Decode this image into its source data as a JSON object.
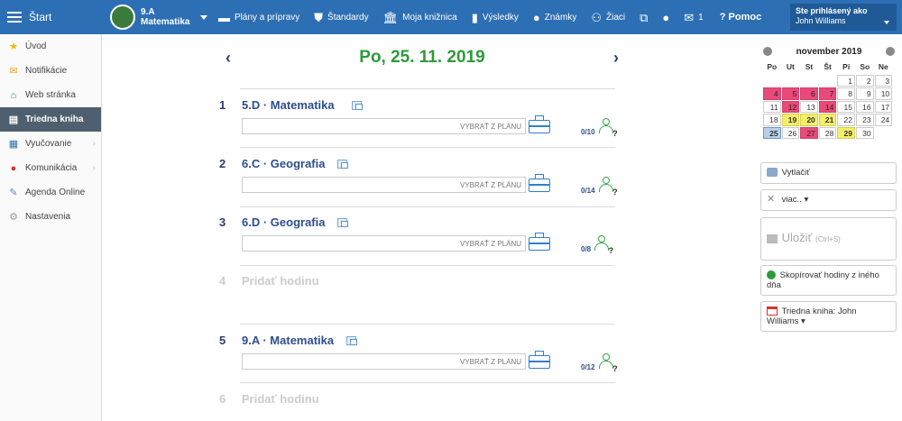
{
  "topbar": {
    "start_label": "Štart",
    "class_line1": "9.A",
    "class_line2": "Matematika",
    "nav": [
      {
        "icon": "calendar-icon",
        "glyph": "▬",
        "label": "Plány a prípravy"
      },
      {
        "icon": "shield-icon",
        "glyph": "⛊",
        "label": "Štandardy"
      },
      {
        "icon": "library-icon",
        "glyph": "🏛",
        "label": "Moja knižnica"
      },
      {
        "icon": "bar-chart-icon",
        "glyph": "▮",
        "label": "Výsledky"
      },
      {
        "icon": "grade-icon",
        "glyph": "●",
        "label": "Známky"
      },
      {
        "icon": "students-icon",
        "glyph": "⚇",
        "label": "Žiaci"
      },
      {
        "icon": "cast-icon",
        "glyph": "⧉",
        "label": ""
      },
      {
        "icon": "chat-icon",
        "glyph": "●",
        "label": ""
      },
      {
        "icon": "mail-icon",
        "glyph": "✉",
        "label": "1"
      }
    ],
    "help_label": "? Pomoc",
    "user_line1": "Ste prihlásený ako",
    "user_line2": "John Williams"
  },
  "sidebar": {
    "items": [
      {
        "label": "Úvod",
        "icon": "star-icon",
        "glyph": "★",
        "color": "#f0b400",
        "active": false,
        "chevron": false
      },
      {
        "label": "Notifikácie",
        "icon": "envelope-icon",
        "glyph": "✉",
        "color": "#f5a623",
        "active": false,
        "chevron": false
      },
      {
        "label": "Web stránka",
        "icon": "house-icon",
        "glyph": "⌂",
        "color": "#1e9a4a",
        "active": false,
        "chevron": false
      },
      {
        "label": "Triedna kniha",
        "icon": "book-icon",
        "glyph": "▤",
        "color": "#ffffff",
        "active": true,
        "chevron": false
      },
      {
        "label": "Vyučovanie",
        "icon": "teaching-icon",
        "glyph": "▦",
        "color": "#2d6fb4",
        "active": false,
        "chevron": true
      },
      {
        "label": "Komunikácia",
        "icon": "communication-icon",
        "glyph": "●",
        "color": "#d9342b",
        "active": false,
        "chevron": true
      },
      {
        "label": "Agenda Online",
        "icon": "pen-icon",
        "glyph": "✎",
        "color": "#5b7fc8",
        "active": false,
        "chevron": false
      },
      {
        "label": "Nastavenia",
        "icon": "gear-icon",
        "glyph": "⚙",
        "color": "#999999",
        "active": false,
        "chevron": false
      }
    ]
  },
  "main": {
    "date_title": "Po, 25. 11. 2019",
    "prev_arrow": "‹",
    "next_arrow": "›",
    "lessons": [
      {
        "num": "1",
        "title": "5.D · Matematika",
        "plan_label": "VYBRAŤ Z PLÁNU",
        "attendance": "0/10"
      },
      {
        "num": "2",
        "title": "6.C · Geografia",
        "plan_label": "VYBRAŤ Z PLÁNU",
        "attendance": "0/14"
      },
      {
        "num": "3",
        "title": "6.D · Geografia",
        "plan_label": "VYBRAŤ Z PLÁNU",
        "attendance": "0/8"
      },
      {
        "num": "5",
        "title": "9.A · Matematika",
        "plan_label": "VYBRAŤ Z PLÁNU",
        "attendance": "0/12"
      }
    ],
    "empty_slots": [
      {
        "num": "4",
        "label": "Pridať hodinu"
      },
      {
        "num": "6",
        "label": "Pridať hodinu"
      }
    ]
  },
  "calendar": {
    "month_label": "november 2019",
    "weekdays": [
      "Po",
      "Ut",
      "St",
      "Št",
      "Pi",
      "So",
      "Ne"
    ],
    "weeks": [
      [
        {
          "d": ""
        },
        {
          "d": ""
        },
        {
          "d": ""
        },
        {
          "d": ""
        },
        {
          "d": "1",
          "s": "plain"
        },
        {
          "d": "2",
          "s": "plain"
        },
        {
          "d": "3",
          "s": "plain"
        }
      ],
      [
        {
          "d": "4",
          "s": "pink"
        },
        {
          "d": "5",
          "s": "pink"
        },
        {
          "d": "6",
          "s": "pink"
        },
        {
          "d": "7",
          "s": "pink"
        },
        {
          "d": "8",
          "s": "plain"
        },
        {
          "d": "9",
          "s": "plain"
        },
        {
          "d": "10",
          "s": "plain"
        }
      ],
      [
        {
          "d": "11",
          "s": "plain"
        },
        {
          "d": "12",
          "s": "pink"
        },
        {
          "d": "13",
          "s": "plain"
        },
        {
          "d": "14",
          "s": "pink"
        },
        {
          "d": "15",
          "s": "plain"
        },
        {
          "d": "16",
          "s": "plain"
        },
        {
          "d": "17",
          "s": "plain"
        }
      ],
      [
        {
          "d": "18",
          "s": "plain"
        },
        {
          "d": "19",
          "s": "yellow"
        },
        {
          "d": "20",
          "s": "yellow"
        },
        {
          "d": "21",
          "s": "yellow"
        },
        {
          "d": "22",
          "s": "plain"
        },
        {
          "d": "23",
          "s": "plain"
        },
        {
          "d": "24",
          "s": "plain"
        }
      ],
      [
        {
          "d": "25",
          "s": "today"
        },
        {
          "d": "26",
          "s": "plain"
        },
        {
          "d": "27",
          "s": "pink"
        },
        {
          "d": "28",
          "s": "plain"
        },
        {
          "d": "29",
          "s": "yellow"
        },
        {
          "d": "30",
          "s": "plain"
        },
        {
          "d": ""
        }
      ]
    ]
  },
  "actions": {
    "print_label": "Vytlačiť",
    "more_label": "viac.. ▾",
    "save_label": "Uložiť",
    "save_shortcut": "(Ctrl+S)",
    "copy_label": "Skopírovať hodiny z iného dňa",
    "classbook_label": "Triedna kniha: John Williams ▾"
  },
  "colors": {
    "topbar": "#2d6fb4",
    "date_green": "#2e9a3a",
    "lesson_title": "#2d4e8e",
    "highlight_pink": "#e84a7a",
    "highlight_yellow": "#f4ef6a",
    "today_blue": "#b9cfe6"
  }
}
